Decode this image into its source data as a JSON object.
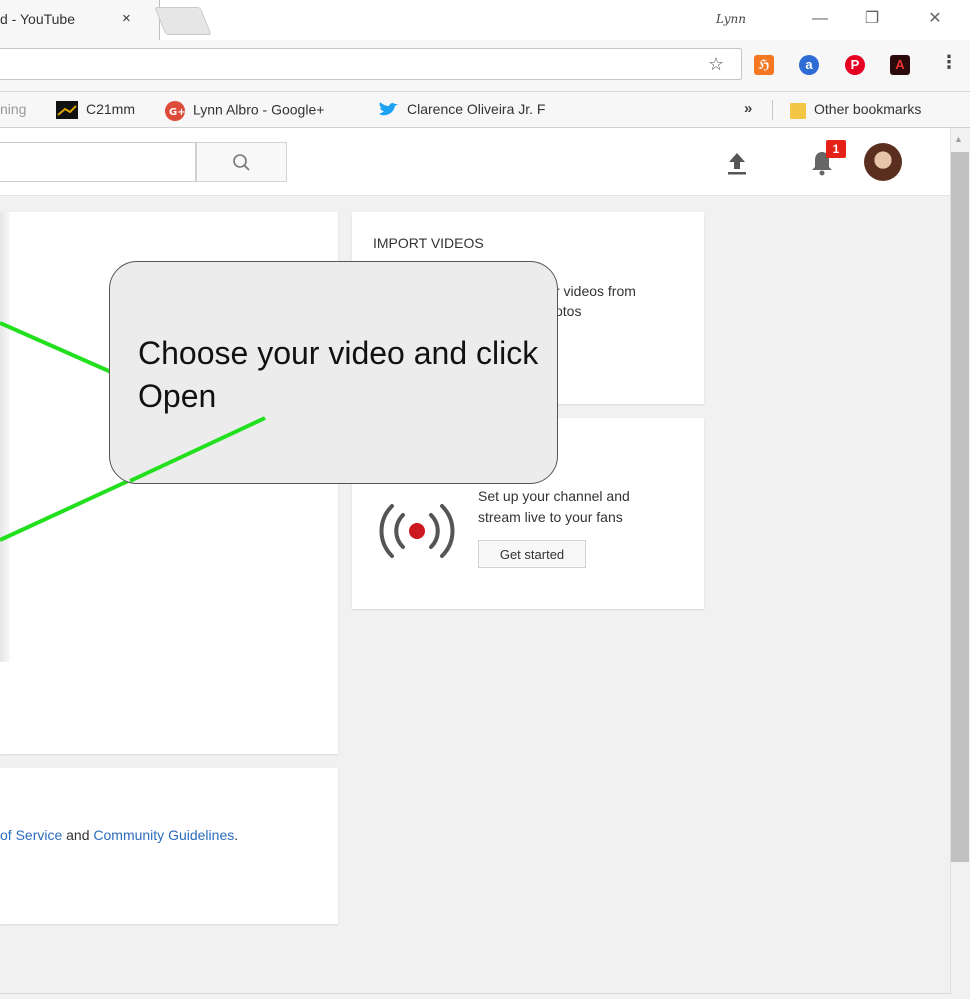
{
  "browser": {
    "tab_title": "d - YouTube",
    "tab_close": "×",
    "profile_name": "Lynn",
    "minimize": "—",
    "restore": "❐",
    "close": "✕",
    "star": "☆",
    "menu": "⋮"
  },
  "extensions": [
    {
      "name": "hubspot-icon",
      "glyph": "ℌ",
      "color": "#f57722"
    },
    {
      "name": "amazon-assistant-icon",
      "glyph": "a",
      "color": "#2e6bd3"
    },
    {
      "name": "pinterest-icon",
      "glyph": "P",
      "color": "#e60023"
    },
    {
      "name": "adobe-acrobat-icon",
      "glyph": "A",
      "color": "#2a0a0a"
    }
  ],
  "bookmarks": {
    "items": [
      {
        "label": "ning"
      },
      {
        "label": "C21mm"
      },
      {
        "label": "Lynn Albro - Google+"
      },
      {
        "label": "Clarence Oliveira Jr. F"
      }
    ],
    "more": "»",
    "other": "Other bookmarks"
  },
  "header": {
    "notification_count": "1"
  },
  "import_card": {
    "title": "IMPORT VIDEOS",
    "text_line1": "r videos from",
    "text_line2": "otos"
  },
  "live_card": {
    "text_line1": "Set up your channel and",
    "text_line2": "stream live to your fans",
    "button": "Get started"
  },
  "terms": {
    "link1": "of Service",
    "and": "and",
    "link2": "Community Guidelines",
    "end": "."
  },
  "callout": {
    "text": "Choose your video and click Open"
  },
  "colors": {
    "annotation_line": "#22e01e",
    "badge": "#e62117",
    "link": "#2b6bbd"
  }
}
